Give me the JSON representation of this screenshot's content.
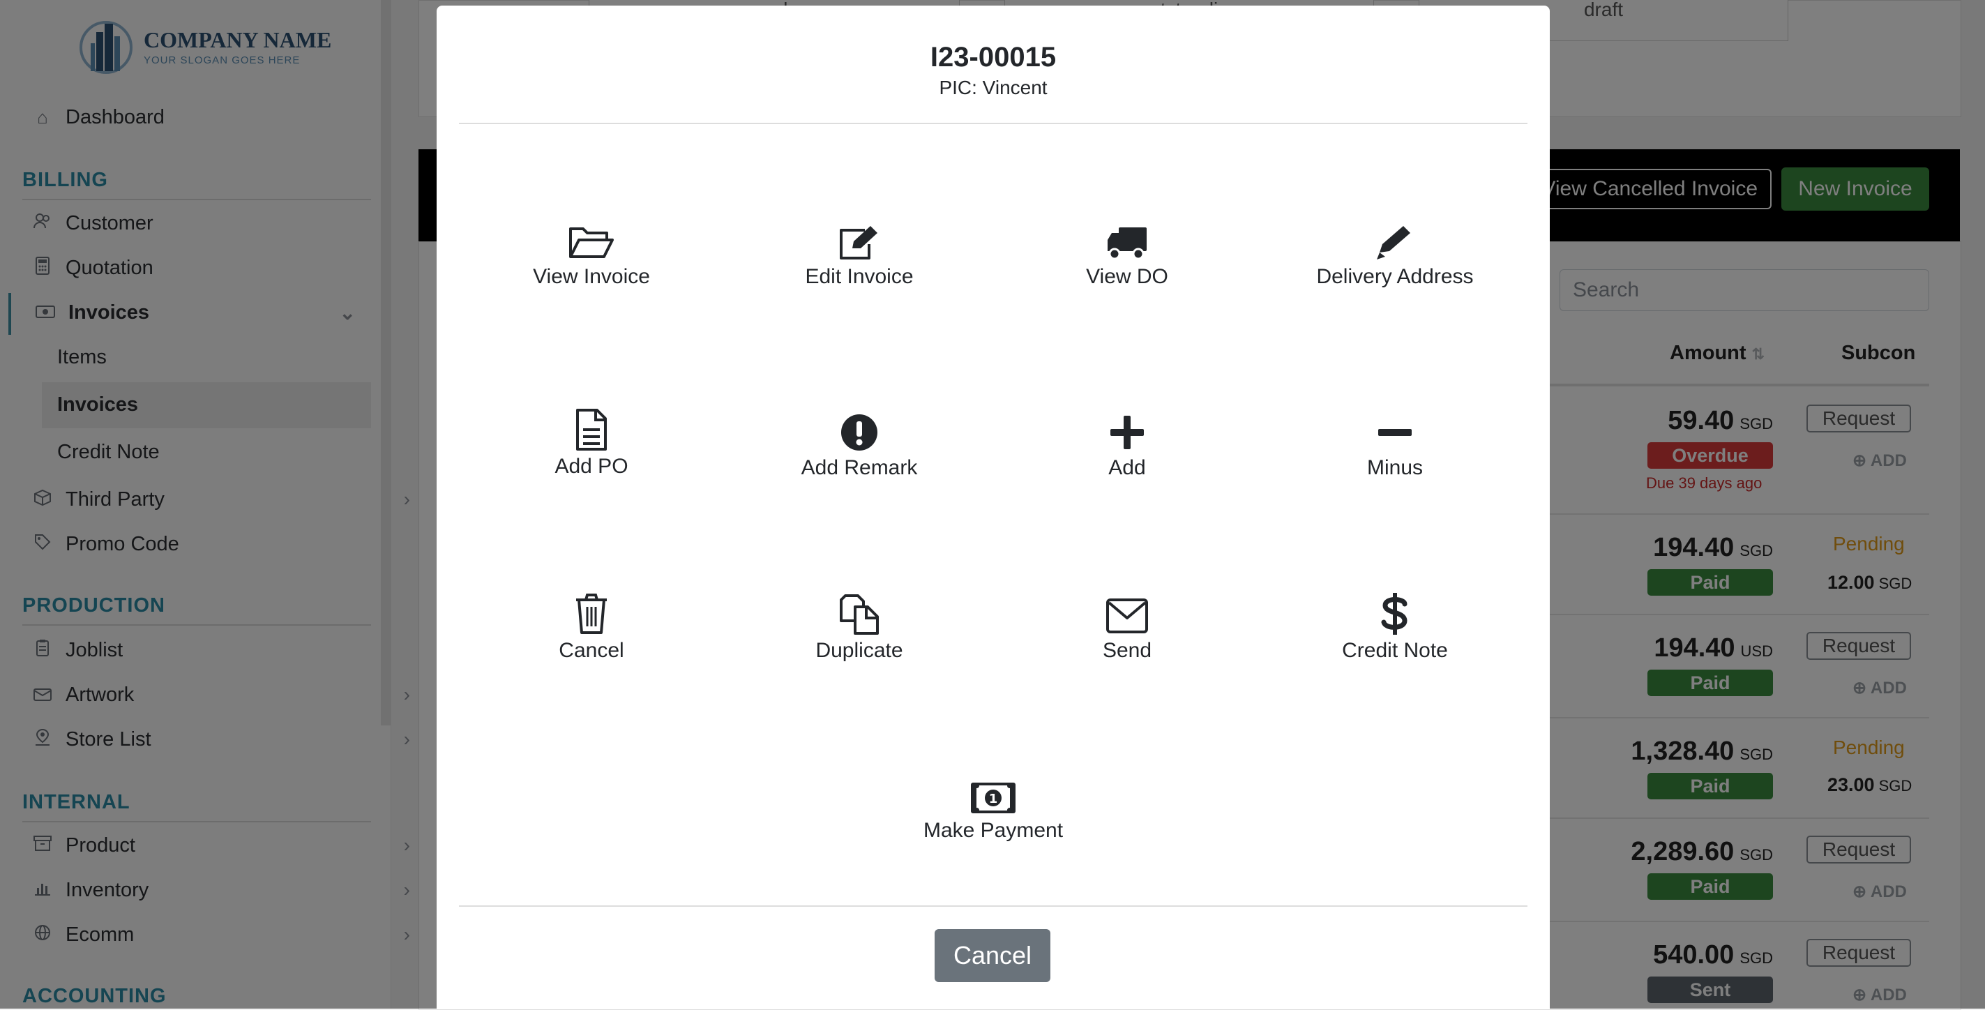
{
  "sidebar": {
    "logo": {
      "name": "COMPANY NAME",
      "slogan": "YOUR SLOGAN GOES HERE"
    },
    "dashboard": "Dashboard",
    "sections": {
      "billing": "BILLING",
      "production": "PRODUCTION",
      "internal": "INTERNAL",
      "accounting": "ACCOUNTING"
    },
    "billing_items": {
      "customer": "Customer",
      "quotation": "Quotation",
      "invoices": "Invoices",
      "invoices_sub": [
        "Items",
        "Invoices",
        "Credit Note"
      ],
      "third_party": "Third Party",
      "promo_code": "Promo Code"
    },
    "production_items": {
      "joblist": "Joblist",
      "artwork": "Artwork",
      "store_list": "Store List"
    },
    "internal_items": {
      "product": "Product",
      "inventory": "Inventory",
      "ecomm": "Ecomm"
    }
  },
  "main": {
    "stats": [
      "overdue",
      "outstanding",
      "draft"
    ],
    "view_cancelled": "View Cancelled Invoice",
    "new_invoice": "New Invoice",
    "search_placeholder": "Search",
    "columns": {
      "amount": "Amount",
      "subcon": "Subcon"
    },
    "request_label": "Request",
    "add_label": "ADD",
    "pending_label": "Pending",
    "rows": [
      {
        "amount": "59.40",
        "currency": "SGD",
        "status": "Overdue",
        "due": "Due 39 days ago",
        "subcon": "request"
      },
      {
        "amount": "194.40",
        "currency": "SGD",
        "status": "Paid",
        "subcon": "pending",
        "subcon_amount": "12.00",
        "subcon_currency": "SGD"
      },
      {
        "amount": "194.40",
        "currency": "USD",
        "status": "Paid",
        "subcon": "request"
      },
      {
        "amount": "1,328.40",
        "currency": "SGD",
        "status": "Paid",
        "subcon": "pending",
        "subcon_amount": "23.00",
        "subcon_currency": "SGD"
      },
      {
        "amount": "2,289.60",
        "currency": "SGD",
        "status": "Paid",
        "subcon": "request"
      },
      {
        "amount": "540.00",
        "currency": "SGD",
        "status": "Sent",
        "subcon": "request"
      }
    ]
  },
  "modal": {
    "title": "I23-00015",
    "subtitle": "PIC: Vincent",
    "actions": {
      "view_invoice": "View Invoice",
      "edit_invoice": "Edit Invoice",
      "view_do": "View DO",
      "delivery_address": "Delivery Address",
      "add_po": "Add PO",
      "add_remark": "Add Remark",
      "add": "Add",
      "minus": "Minus",
      "cancel": "Cancel",
      "duplicate": "Duplicate",
      "send": "Send",
      "credit_note": "Credit Note",
      "make_payment": "Make Payment"
    },
    "cancel_button": "Cancel"
  },
  "colors": {
    "accent": "#2a8aa4",
    "success": "#3a8a3e",
    "danger": "#d83a3a",
    "warning": "#e09a18"
  }
}
